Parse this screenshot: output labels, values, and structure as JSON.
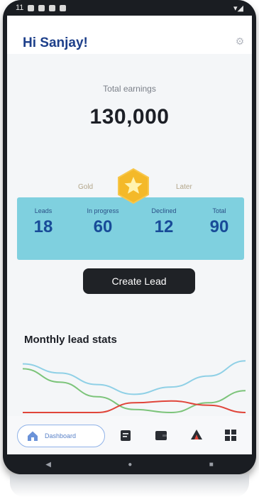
{
  "status_bar": {
    "left_text": "11",
    "right_text": "▾◢"
  },
  "header": {
    "greeting": "Hi Sanjay!",
    "link_text": "",
    "icon": "settings-icon"
  },
  "earnings": {
    "label": "Total earnings",
    "value": "130,000",
    "unit": ""
  },
  "tier": {
    "current": "Gold",
    "next": "Later",
    "badge_icon": "star-icon",
    "badge_color": "#f4b929"
  },
  "stats": [
    {
      "label": "Leads",
      "value": "18"
    },
    {
      "label": "In progress",
      "value": "60"
    },
    {
      "label": "Declined",
      "value": "12"
    },
    {
      "label": "Total",
      "value": "90"
    }
  ],
  "cta": {
    "label": "Create Lead"
  },
  "chart_section": {
    "title": "Monthly lead stats",
    "subtitle": ""
  },
  "chart_data": {
    "type": "line",
    "title": "Monthly lead stats",
    "x": [
      0,
      1,
      2,
      3,
      4,
      5,
      6
    ],
    "series": [
      {
        "color": "#8fd0e6",
        "values": [
          8,
          6.5,
          4.6,
          3,
          4.2,
          6,
          8.5
        ]
      },
      {
        "color": "#7cc47a",
        "values": [
          7.2,
          5,
          2.6,
          0.5,
          0,
          1.6,
          3.6
        ]
      },
      {
        "color": "#e0453a",
        "values": [
          0,
          0,
          0,
          1.6,
          1.9,
          1.2,
          0
        ]
      }
    ],
    "xlabel": "",
    "ylabel": "",
    "ylim": [
      0,
      9
    ],
    "grid": false
  },
  "bottom_nav": {
    "home_label": "Dashboard",
    "items": [
      "home-icon",
      "document-icon",
      "wallet-icon",
      "tent-icon",
      "grid-icon"
    ],
    "accent": "#5a82c8"
  },
  "system_nav": {
    "back": "◀",
    "home": "●",
    "recents": "■"
  }
}
